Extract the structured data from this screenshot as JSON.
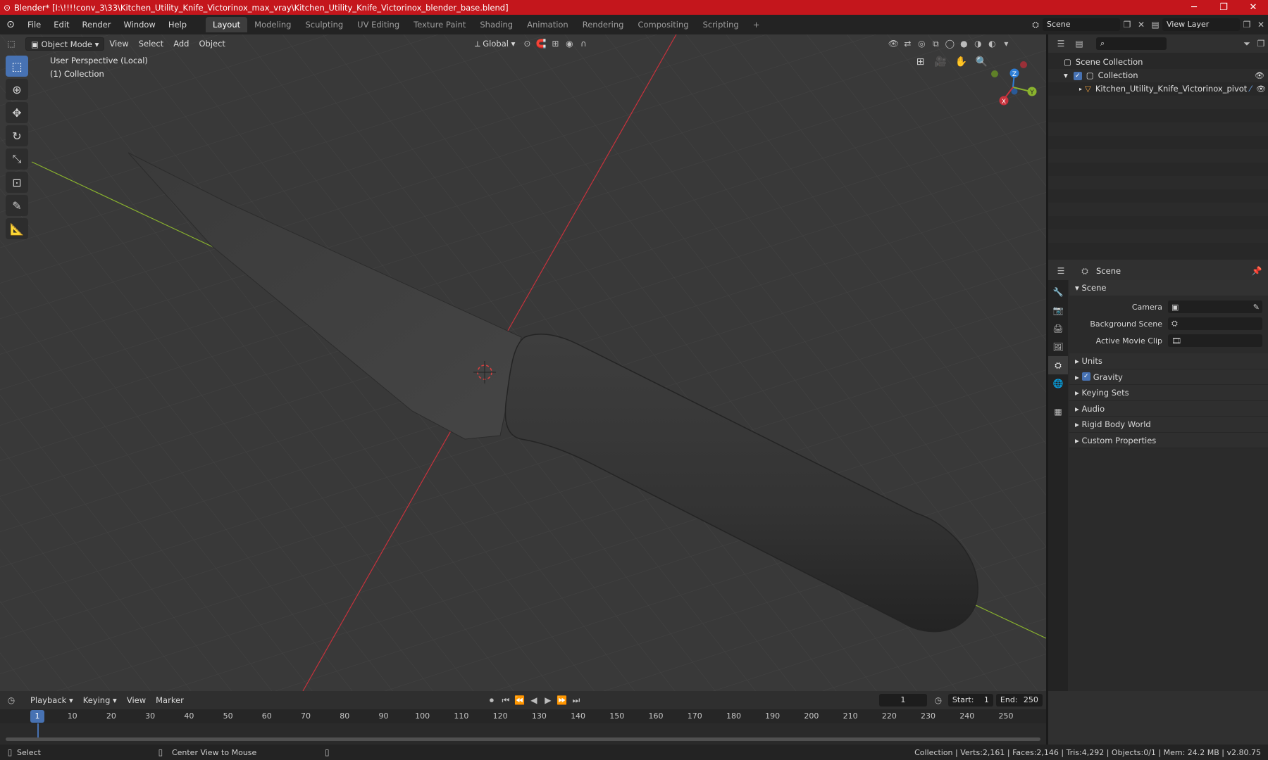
{
  "window": {
    "title": "Blender* [I:\\!!!!conv_3\\33\\Kitchen_Utility_Knife_Victorinox_max_vray\\Kitchen_Utility_Knife_Victorinox_blender_base.blend]",
    "minimize": "─",
    "maximize": "❐",
    "close": "✕"
  },
  "menu": [
    "File",
    "Edit",
    "Render",
    "Window",
    "Help"
  ],
  "workspaces": [
    "Layout",
    "Modeling",
    "Sculpting",
    "UV Editing",
    "Texture Paint",
    "Shading",
    "Animation",
    "Rendering",
    "Compositing",
    "Scripting"
  ],
  "workspace_add": "+",
  "scene_field": "Scene",
  "view_layer_field": "View Layer",
  "viewport": {
    "mode": "Object Mode",
    "menus": [
      "View",
      "Select",
      "Add",
      "Object"
    ],
    "transform_orientation": "Global",
    "info_line1": "User Perspective (Local)",
    "info_line2": "(1) Collection",
    "gizmo": {
      "x": "X",
      "y": "Y",
      "z": "Z"
    }
  },
  "outliner": {
    "rows": [
      {
        "label": "Scene Collection"
      },
      {
        "label": "Collection"
      },
      {
        "label": "Kitchen_Utility_Knife_Victorinox_pivot"
      }
    ]
  },
  "properties": {
    "header": "Scene",
    "panel": "Scene",
    "rows": [
      {
        "label": "Camera",
        "value": ""
      },
      {
        "label": "Background Scene",
        "value": ""
      },
      {
        "label": "Active Movie Clip",
        "value": ""
      }
    ],
    "subpanels": [
      "Units",
      "Gravity",
      "Keying Sets",
      "Audio",
      "Rigid Body World",
      "Custom Properties"
    ]
  },
  "timeline": {
    "menus": [
      "Playback",
      "Keying",
      "View",
      "Marker"
    ],
    "current_frame": "1",
    "start_label": "Start:",
    "start": "1",
    "end_label": "End:",
    "end": "250",
    "ticks": [
      "10",
      "20",
      "30",
      "40",
      "50",
      "60",
      "70",
      "80",
      "90",
      "100",
      "110",
      "120",
      "130",
      "140",
      "150",
      "160",
      "170",
      "180",
      "190",
      "200",
      "210",
      "220",
      "230",
      "240",
      "250"
    ]
  },
  "status": {
    "select": "Select",
    "center": "Center View to Mouse",
    "stats": "Collection | Verts:2,161 | Faces:2,146 | Tris:4,292 | Objects:0/1 | Mem: 24.2 MB | v2.80.75"
  },
  "colors": {
    "title_bar": "#c4161c",
    "accent": "#4772b3",
    "x_axis": "#c8323c",
    "y_axis": "#8ab32e",
    "z_axis": "#2d7ed8"
  }
}
